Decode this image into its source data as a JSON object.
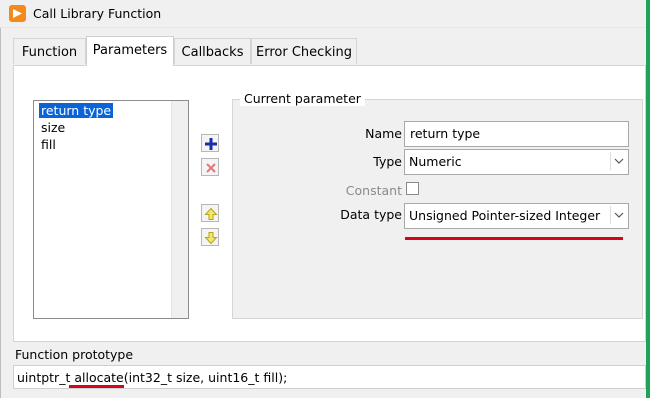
{
  "window": {
    "title": "Call Library Function",
    "accent_color": "#1fa35a",
    "icon_color": "#f28a1e"
  },
  "tabs": [
    {
      "label": "Function",
      "active": false
    },
    {
      "label": "Parameters",
      "active": true
    },
    {
      "label": "Callbacks",
      "active": false
    },
    {
      "label": "Error Checking",
      "active": false
    }
  ],
  "parameters_list": {
    "items": [
      "return type",
      "size",
      "fill"
    ],
    "selected_index": 0
  },
  "side_buttons": {
    "add_icon": "plus-icon",
    "delete_icon": "x-icon",
    "move_up_icon": "arrow-up-icon",
    "move_down_icon": "arrow-down-icon"
  },
  "current_parameter": {
    "group_title": "Current parameter",
    "name_label": "Name",
    "name_value": "return type",
    "type_label": "Type",
    "type_value": "Numeric",
    "constant_label": "Constant",
    "constant_checked": false,
    "data_type_label": "Data type",
    "data_type_value": "Unsigned Pointer-sized Integer"
  },
  "prototype": {
    "label": "Function prototype",
    "return_type": "uintptr_t",
    "function_name": "allocate",
    "arguments": "(int32_t size, uint16_t fill);"
  },
  "annotation_color": "#d4061c"
}
